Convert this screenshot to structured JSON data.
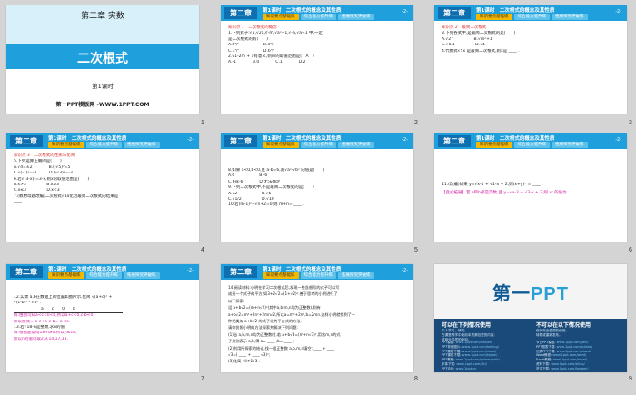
{
  "slides": {
    "s1": {
      "number": "1",
      "chapter": "第二章 实数",
      "title": "二次根式",
      "subtitle": "第1课时",
      "brand": "第一PPT模板网 -WWW.1PPT.COM"
    },
    "header": {
      "chapter_label": "第二章",
      "lesson_title": "第1课时　二次根式的概念及其性质",
      "tab1": "知识要点基础练",
      "tab2": "综合能力提升练",
      "tab3": "拓展探究突破练",
      "page_marker": "-2-"
    },
    "s2": {
      "number": "2",
      "lines": [
        "知识点 1　二次根式的概念",
        "1.下列式子:√5,√2a,∛-m,√a²+1,√-a,√a+1 中,一定",
        "是二次根式的有(　　)",
        "A.5个　　　　　　B.4个",
        "C.3个　　　　　　D.6个",
        "2.√1-2m + 1有意义,则m的取值范围是(　A　)",
        "A.-1　　　　B.0　　　　C.1　　　　D.2"
      ]
    },
    "s3": {
      "number": "3",
      "lines": [
        "知识点 2　最简二次根式",
        "3.下列各式中,是最简二次根式的是(　　)",
        "A.√27　　　　　B.√m²+1",
        "C.√0.1　　　　　D.√4",
        "4.代数式√5x 是最简二次根式,则x是 ____ ."
      ]
    },
    "s4": {
      "number": "4",
      "lines": [
        "知识点 3　二次根式的性质与化简",
        "5.下列运算正确的是(　　)",
        "A.√4=±2　　　　B.(-√5)²=5",
        "C.√(-7)²=-7　　　D.(-√3)²=-3",
        "6.若√(3-x)²=3-x,则x的取值范围是(　　)",
        "A.x>3　　　　　B.x≥3",
        "C.x≤3　　　　　D.x<3",
        "7.(教材母题改编)二次根式√4a化为最简二次根式的结果是",
        "____ ."
      ]
    },
    "s5": {
      "number": "5",
      "lines": [
        "8.如果 a<0,b<0,且 a-b=6,则√a²-√b² 的值是(　　)",
        "A.6　　　　　　B.-6",
        "C.6或-6　　　　D.无法确定",
        "9.下列二次根式中,不是最简二次根式的是(　　)",
        "A.√2　　　　　　B.√6",
        "C.√1/2　　　　　D.√10",
        "10.若(m-1)²+√n+2=0,则 m+n= ____ ."
      ]
    },
    "s6": {
      "number": "6",
      "lines": [
        "11.(改编)如果 y=√x-1 + √1-x + 2,则(x+y)ˣ = ____ .",
        "【变式拓展】若 a和b都是实数,且 y=√x-3 + √3-x + 2,则 xʸ 的值为",
        "____ ."
      ]
    },
    "s7": {
      "number": "7",
      "lines": [
        "12.实数 a,b在数轴上的位置如图所示,化简 √(a+c)² +",
        "√(c-b)² - √b² .",
        "a　　c　　0　　b",
        "解:由图可知a<c<0<b,所以a+c<0,c-b<0,",
        "所以原式=-a-c+b-c-b=-a-2c.",
        "13.若√18-n是整数,求n的值.",
        "解:根据题意得18-n≥0,所以n≤18,",
        "所以n的值可取2,9,14,17,18."
      ]
    },
    "s8": {
      "number": "8",
      "lines": [
        "14.阅读材料:小明在学习二次根式后,发现一些含根号的式子可以写",
        "成另一个式子的平方,如3+2√2=(1+√2)².善于思考的小明进行了",
        "以下探索:",
        "设 a+b√2=(m+n√2)²(其中a,b,m,n均为正整数),则有",
        "a+b√2=m²+2n²+2mn√2,所以a=m²+2n²,b=2mn.这样小明就找到了一",
        "种把类似 a+b√2 的式子化为平方式的方法.",
        "请你仿照小明的方法探索并解决下列问题:",
        "(1)当 a,b,m,n均为正整数时,若 a+b√3=(m+n√3)²,用含m,n的式",
        "子分别表示 a,b,得 a= ____ ,b= ____ ;",
        "(2)利用所探索的结论,找一组正整数 a,b,m,n填空: ____ + ____",
        "√3=( ____ + ____ √3)²;",
        "(3)化简 √4+2√3 ."
      ]
    },
    "s9": {
      "number": "9",
      "logo_main": "第一",
      "logo_accent": "PPT",
      "left_heading": "可以在下列情况使用",
      "left_notes": [
        "个人学习、研究;",
        "在课堂教学中使用本资源包里的内容;",
        "非商业性质的使用。"
      ],
      "right_heading": "不可以在以下情况使用",
      "right_notes": [
        "任何商业性质的使用;",
        "转载或重新发布。"
      ],
      "left_rows": [
        {
          "k": "PPT模板:",
          "v": "www.1ppt.com/moban/"
        },
        {
          "k": "PPT背景图片:",
          "v": "www.1ppt.com/beijing/"
        },
        {
          "k": "PPT素材下载:",
          "v": "www.1ppt.com/sucai/"
        },
        {
          "k": "PPT课件下载:",
          "v": "www.1ppt.com/kejian/"
        },
        {
          "k": "PPT教程:",
          "v": "www.1ppt.com/powerpoint/"
        },
        {
          "k": "字体下载:",
          "v": "www.1ppt.com/ziti/"
        },
        {
          "k": "PPT论坛:",
          "v": "www.1ppt.cn"
        }
      ],
      "right_rows": [
        {
          "k": "节日PPT模板:",
          "v": "www.1ppt.com/jieri/"
        },
        {
          "k": "PPT图表下载:",
          "v": "www.1ppt.com/tubiao/"
        },
        {
          "k": "优秀PPT下载:",
          "v": "www.1ppt.com/xiazai/"
        },
        {
          "k": "Word教程:",
          "v": "www.1ppt.com/word/"
        },
        {
          "k": "Excel教程:",
          "v": "www.1ppt.com/excel/"
        },
        {
          "k": "资料下载:",
          "v": "www.1ppt.com/ziliao/"
        },
        {
          "k": "范文下载:",
          "v": "www.1ppt.com/fanwen/"
        }
      ]
    }
  }
}
